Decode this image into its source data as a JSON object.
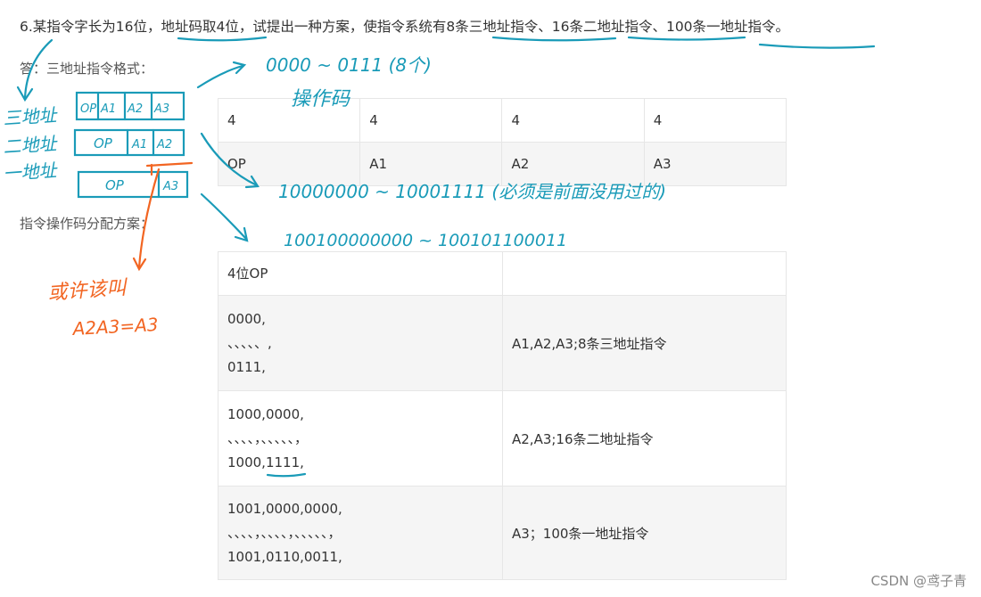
{
  "question": "6.某指令字长为16位，地址码取4位，试提出一种方案，使指令系统有8条三地址指令、16条二地址指令、100条一地址指令。",
  "answer_label": "答：三地址指令格式：",
  "format_table": {
    "row1": [
      "4",
      "4",
      "4",
      "4"
    ],
    "row2": [
      "OP",
      "A1",
      "A2",
      "A3"
    ]
  },
  "scheme_label": "指令操作码分配方案：",
  "opcode_table": {
    "header": [
      "4位OP",
      ""
    ],
    "rows": [
      {
        "codes": [
          "0000,",
          "、、、、、,",
          "0111,"
        ],
        "desc": "A1,A2,A3;8条三地址指令"
      },
      {
        "codes": [
          "1000,0000,",
          "、、、、，、、、、、，",
          "1000,1111,"
        ],
        "desc": "A2,A3;16条二地址指令"
      },
      {
        "codes": [
          "1001,0000,0000,",
          "、、、、，、、、、，、、、、、，",
          "1001,0110,0011,"
        ],
        "desc": "A3；100条一地址指令"
      }
    ]
  },
  "footer": "CSDN @鸢子青",
  "annotations": {
    "three_addr": "三地址",
    "two_addr": "二地址",
    "one_addr": "一地址",
    "box3": [
      "OP",
      "A1",
      "A2",
      "A3"
    ],
    "box2": [
      "OP",
      "A1",
      "A2"
    ],
    "box1": [
      "OP",
      "A3"
    ],
    "range1": "0000 ~ 0111 (8个)",
    "opcode_note": "操作码",
    "range2": "10000000 ~ 10001111 (必须是前面没用过的)",
    "range3": "100100000000 ~ 100101100011",
    "maybe_note": "或许该叫",
    "maybe_note2": "A2A3=A3",
    "ink_blue": "#1a9bb8",
    "ink_orange": "#f26522"
  }
}
